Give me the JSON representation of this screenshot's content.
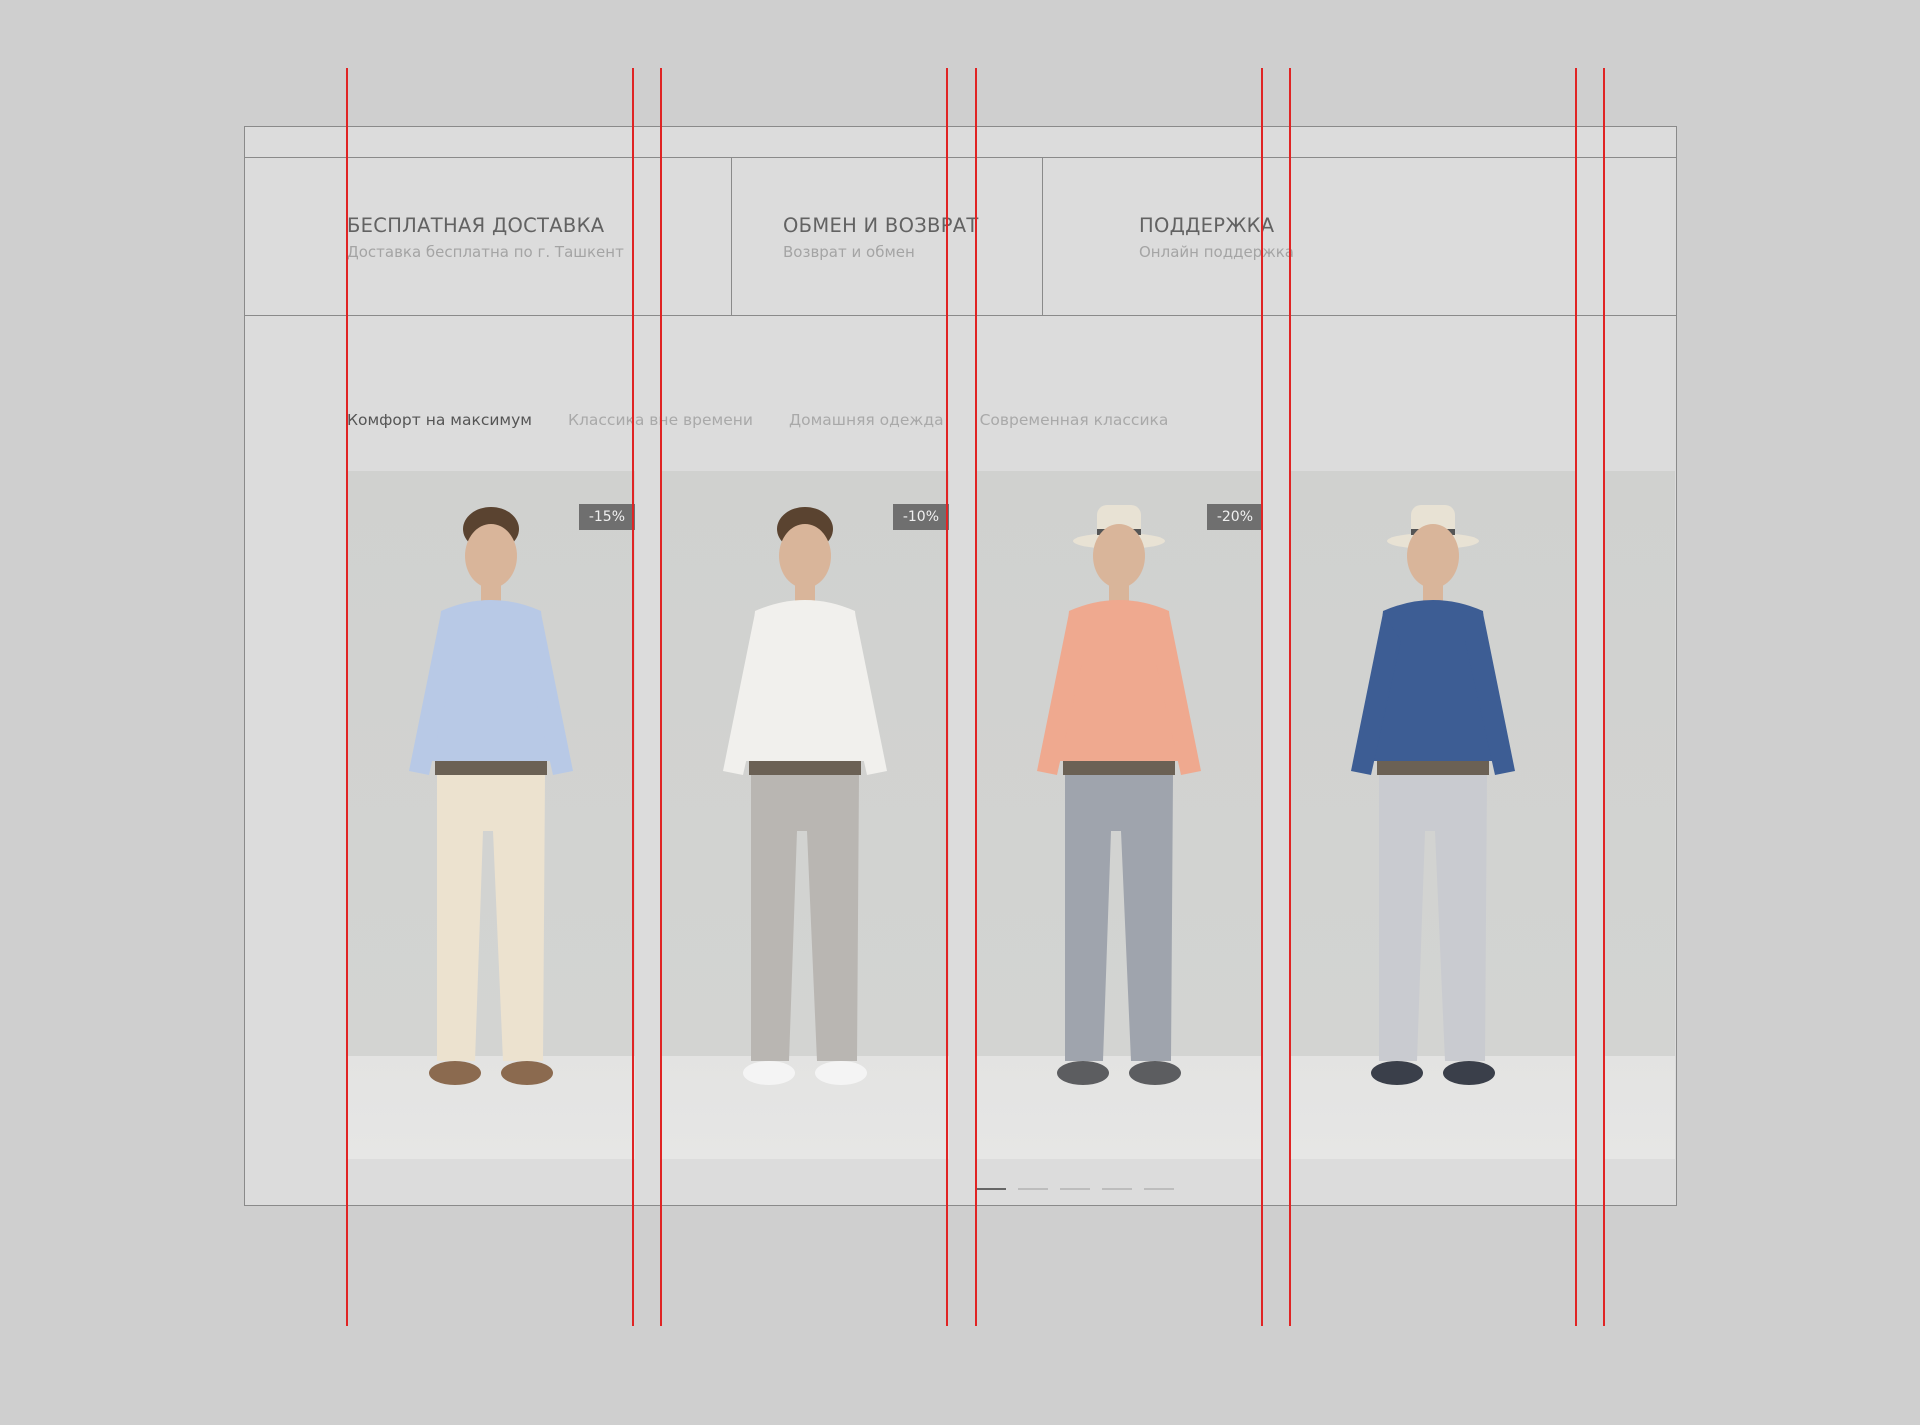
{
  "features": [
    {
      "title": "БЕСПЛАТНАЯ ДОСТАВКА",
      "subtitle": "Доставка бесплатна по г. Ташкент"
    },
    {
      "title": "ОБМЕН И ВОЗВРАТ",
      "subtitle": "Возврат и обмен"
    },
    {
      "title": "ПОДДЕРЖКА",
      "subtitle": "Онлайн поддержка"
    }
  ],
  "tabs": [
    {
      "label": "Комфорт на максимум",
      "active": true
    },
    {
      "label": "Классика вне времени",
      "active": false
    },
    {
      "label": "Домашняя одежда",
      "active": false
    },
    {
      "label": "Современная классика",
      "active": false
    }
  ],
  "products": [
    {
      "badge": "-15%",
      "icon": "model-light-blue-shirt-beige-trousers",
      "shirt": "#b8c9e6",
      "pants": "#ece2cf",
      "shoes": "#8b6a4f"
    },
    {
      "badge": "-10%",
      "icon": "model-white-shirt-grey-trousers",
      "shirt": "#f1f0ed",
      "pants": "#b9b6b2",
      "shoes": "#f4f4f4"
    },
    {
      "badge": "-20%",
      "icon": "model-pink-shirt-grey-trousers-hat",
      "shirt": "#efa98f",
      "pants": "#9fa4ad",
      "shoes": "#5c5d60"
    },
    {
      "badge": "",
      "icon": "model-navy-shirt-striped-trousers-hat",
      "shirt": "#3d5d94",
      "pants": "#c9cbd0",
      "shoes": "#3a3f4a"
    }
  ],
  "slider": {
    "count": 5,
    "active_index": 0
  },
  "colors": {
    "guides": "#e02424",
    "badge": "#6f6f6f"
  }
}
